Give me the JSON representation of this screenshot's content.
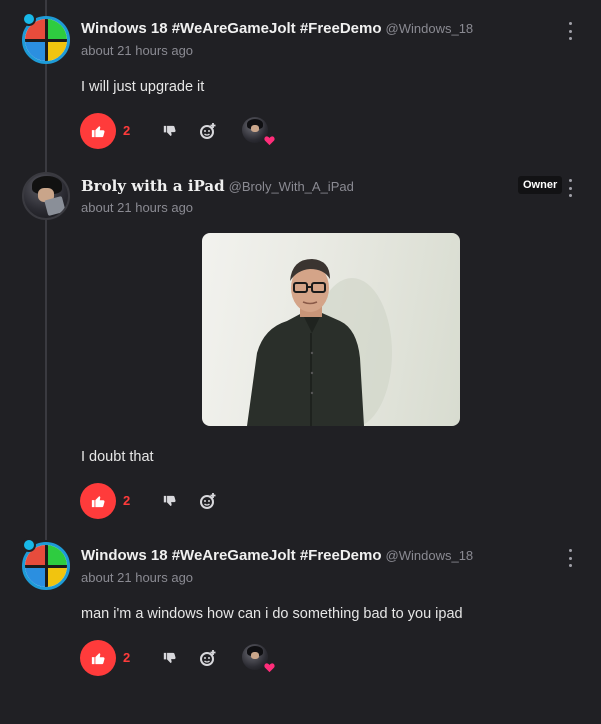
{
  "comments": [
    {
      "username": "Windows 18 #WeAreGameJolt #FreeDemo",
      "handle": "@Windows_18",
      "timestamp": "about 21 hours ago",
      "text": "I will just upgrade it",
      "like_count": "2"
    },
    {
      "username": "Broly with a iPad",
      "handle": "@Broly_With_A_iPad",
      "timestamp": "about 21 hours ago",
      "badge": "Owner",
      "text": "I doubt that",
      "like_count": "2"
    },
    {
      "username": "Windows 18 #WeAreGameJolt #FreeDemo",
      "handle": "@Windows_18",
      "timestamp": "about 21 hours ago",
      "text": "man i'm a windows how can i do something bad to you ipad",
      "like_count": "2"
    }
  ],
  "colors": {
    "background": "#202024",
    "like_active": "#ff3b3b",
    "heart": "#ff2d7a",
    "muted_text": "#8a8a92"
  },
  "icons": [
    "thumbs-up-icon",
    "thumbs-down-icon",
    "reply-icon",
    "more-vertical-icon",
    "heart-icon"
  ]
}
